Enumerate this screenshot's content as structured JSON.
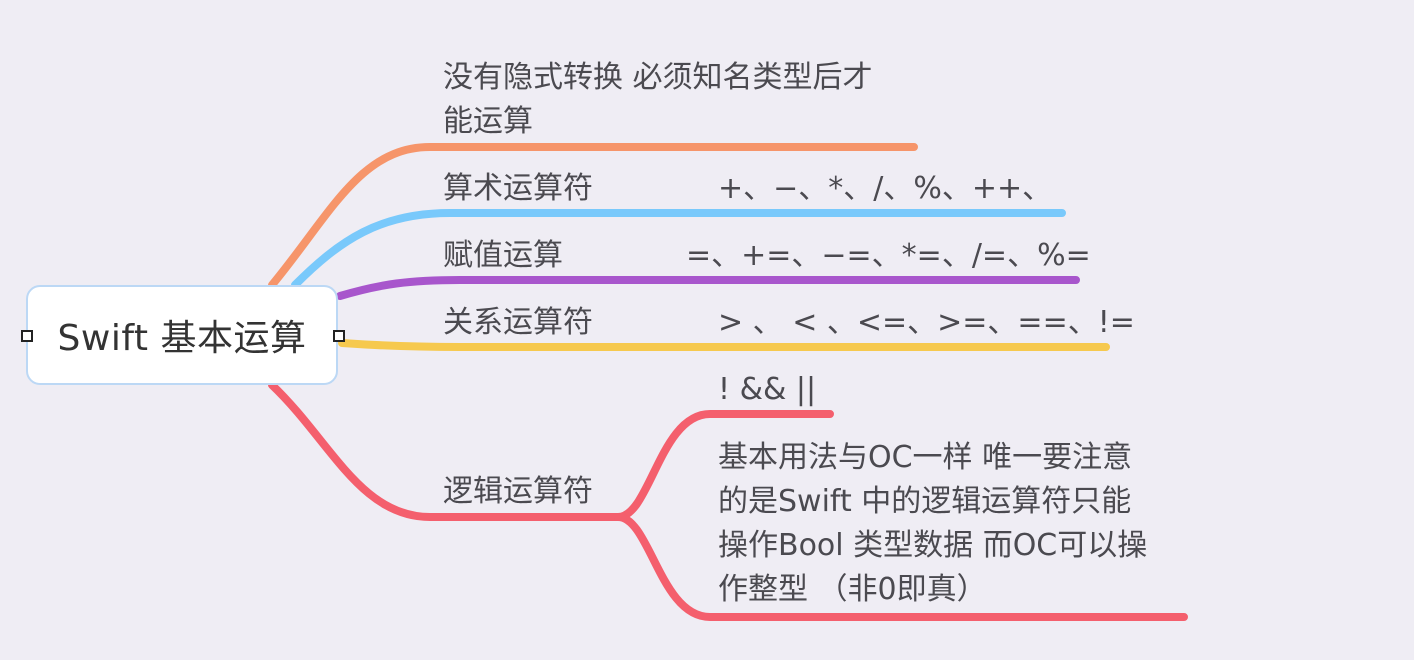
{
  "root": {
    "title": "Swift 基本运算"
  },
  "branches": [
    {
      "title_lines": [
        "没有隐式转换 必须知名类型后才",
        "能运算"
      ],
      "color": "#f6956a"
    },
    {
      "title": "算术运算符",
      "detail": "+、−、*、/、%、++、",
      "color": "#79c9fb"
    },
    {
      "title": "赋值运算",
      "detail": "=、+=、−=、*=、/=、%=",
      "color": "#a856cc"
    },
    {
      "title": "关系运算符",
      "detail": ">  、 <  、<=、>=、==、!=",
      "color": "#f6c94e"
    },
    {
      "title": "逻辑运算符",
      "color": "#f45f6d",
      "children": [
        {
          "text": "! &&  ||"
        },
        {
          "lines": [
            "基本用法与OC一样 唯一要注意",
            "的是Swift 中的逻辑运算符只能",
            "操作Bool 类型数据 而OC可以操",
            "作整型 （非0即真）"
          ]
        }
      ]
    }
  ]
}
